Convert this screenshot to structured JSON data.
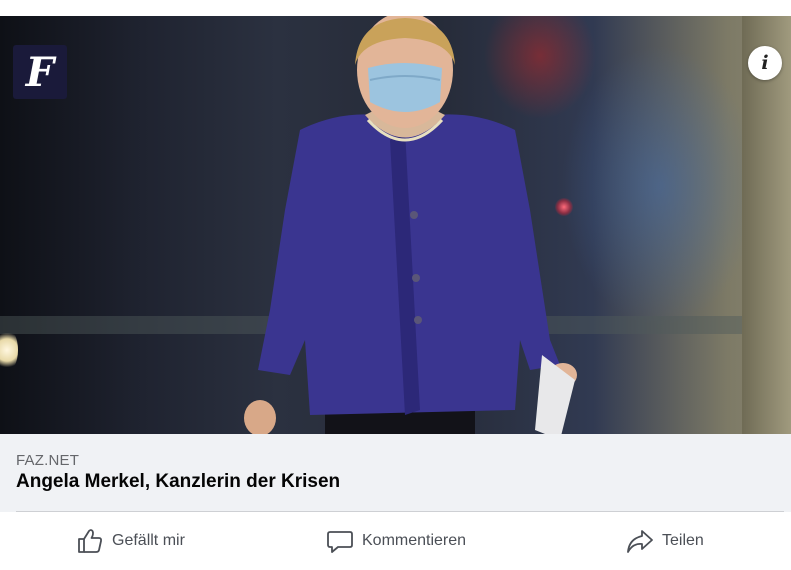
{
  "post": {
    "brand_logo_letter": "F",
    "info_icon_glyph": "i",
    "link": {
      "domain": "FAZ.NET",
      "title": "Angela Merkel, Kanzlerin der Krisen"
    }
  },
  "actions": {
    "like_label": "Gefällt mir",
    "comment_label": "Kommentieren",
    "share_label": "Teilen"
  },
  "icons": {
    "like": "thumbs-up-icon",
    "comment": "speech-bubble-icon",
    "share": "share-arrow-icon",
    "info": "info-icon"
  },
  "colors": {
    "preview_background": "#f0f2f5",
    "action_text": "#4b4f56",
    "title_text": "#050505",
    "domain_text": "#65676b",
    "logo_background": "#1a1a3a"
  }
}
